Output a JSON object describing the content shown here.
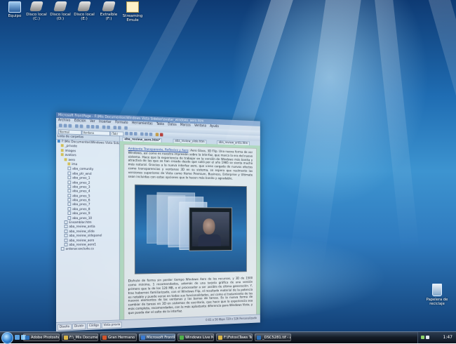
{
  "desktop_icons": [
    {
      "name": "equipo",
      "label": "Equipo",
      "kind": "pc"
    },
    {
      "name": "disco-local-c",
      "label": "Disco local (C:)",
      "kind": "drive"
    },
    {
      "name": "disco-local-d",
      "label": "Disco local (D:)",
      "kind": "drive"
    },
    {
      "name": "disco-local-e",
      "label": "Disco local (E:)",
      "kind": "drive"
    },
    {
      "name": "extraible-f",
      "label": "Extraíble (F:)",
      "kind": "drive"
    },
    {
      "name": "streaming-emule",
      "label": "Streaming Emule",
      "kind": "doc"
    }
  ],
  "recycle_bin": {
    "label": "Papelera de reciclaje"
  },
  "app": {
    "title": "Microsoft FrontPage - F:\\Mis Documentos\\Windows Vista Sidebar\\avatar_windows_aero.htm",
    "menu": [
      "Archivo",
      "Edición",
      "Ver",
      "Insertar",
      "Formato",
      "Herramientas",
      "Tabla",
      "Datos",
      "Marcos",
      "Ventana",
      "Ayuda"
    ],
    "toolbar": {
      "style": "Normal",
      "font": "Verdana",
      "size": "(Tab)"
    },
    "file_panel": {
      "header": "Lista de carpetas",
      "items": [
        {
          "label": "F:\\Mis Documentos\\Windows Vista Sidebar",
          "kind": "site",
          "indent": 0
        },
        {
          "label": "_private",
          "kind": "folder",
          "indent": 1
        },
        {
          "label": "images",
          "kind": "folder",
          "indent": 1
        },
        {
          "label": "avatars",
          "kind": "folder",
          "indent": 1
        },
        {
          "label": "aero",
          "kind": "folder",
          "indent": 2
        },
        {
          "label": "ima",
          "kind": "folder",
          "indent": 3
        },
        {
          "label": "aba_comunity",
          "kind": "file",
          "indent": 3
        },
        {
          "label": "aba_ptr_wnd",
          "kind": "file",
          "indent": 3
        },
        {
          "label": "aba_pnes_1",
          "kind": "file",
          "indent": 3
        },
        {
          "label": "aba_pnes_2",
          "kind": "file",
          "indent": 3
        },
        {
          "label": "aba_pnes_3",
          "kind": "file",
          "indent": 3
        },
        {
          "label": "aba_pnes_4",
          "kind": "file",
          "indent": 3
        },
        {
          "label": "aba_pnes_5",
          "kind": "file",
          "indent": 3
        },
        {
          "label": "aba_pnes_6",
          "kind": "file",
          "indent": 3
        },
        {
          "label": "aba_pnes_7",
          "kind": "file",
          "indent": 3
        },
        {
          "label": "aba_pnes_8",
          "kind": "file",
          "indent": 3
        },
        {
          "label": "aba_pnes_9",
          "kind": "file",
          "indent": 3
        },
        {
          "label": "aba_pnes_10",
          "kind": "file",
          "indent": 3
        },
        {
          "label": "Ensamblar.htm",
          "kind": "file",
          "indent": 2
        },
        {
          "label": "aba_review_antia",
          "kind": "file",
          "indent": 2
        },
        {
          "label": "aba_review_slide",
          "kind": "file",
          "indent": 2
        },
        {
          "label": "aba_review_sidepanel",
          "kind": "file",
          "indent": 2
        },
        {
          "label": "aba_review_aero",
          "kind": "file",
          "indent": 2
        },
        {
          "label": "aba_review_aero1",
          "kind": "file",
          "indent": 2
        },
        {
          "label": "ordenar.exclude.cs",
          "kind": "file",
          "indent": 1
        }
      ]
    },
    "tabs": [
      {
        "label": "aba_review_aero.htm*",
        "active": true
      },
      {
        "label": "aba_review_slide.htm",
        "active": false
      },
      {
        "label": "aba_review_antia.htm",
        "active": false
      }
    ],
    "page_text_top_links": "Ambiente Transparente, Reflexivo y Aero",
    "page_text_top": ": Aero Glass, 3D Flip. Una nueva forma de ver Windows, así como es nuestra impresión sobre la interfaz, que marca la era del nuevo sistema. Hace que la experiencia de trabajar en la versión de Windows más bonita y atractiva de las que se han creado desde que salió por el año 1985 se sienta mucho más natural. Gracias a la nueva interfaz aero, que viene cargada de nuevos efectos como transparencias y ventanas 3D en su sistema, se espera que realmente las versiones superiores de Vista como Home Premium, Business, Enterprise y Ultimate sean incluidas con estas opciones que lo hacen más bonito y agradable.",
    "page_text_bottom": "Disfrute de forma sin perder tiempo Windows Aero de los recursos, y 3D de 1500 como mínimo, 1 recomendados, además de una tarjeta gráfica de una versión primero que la de los 128 MB, o el procesador a ser posible de última generación. Y, tras habernos familiarizado, con el Windows Flip, el resultado material de la potencia es notable y puede verse en todas sus funcionalidades, así como el tratamiento de los nuevos elementos de las ventanas y las barras de tareas. Es la nueva forma de cambiar de tareas en 3D en sistemas de escritorio, que hace que la experiencia sea más completa, recomendados, con la más aplastante diferencia para Windows Vista, y que pueda dar el salto de la interfaz.",
    "status": {
      "tabs": [
        "Diseño",
        "Dividir",
        "Código",
        "Vista previa"
      ],
      "right": "0:01 a 56 Kbps  729 x 526  Personalizado"
    }
  },
  "taskbar": {
    "buttons": [
      {
        "label": "Adobe Photoshop",
        "icon_color": "#2b6fb8",
        "active": false
      },
      {
        "label": "F:\\_Mis Documen...",
        "icon_color": "#d9b64a",
        "active": false
      },
      {
        "label": "Gran Hermano V...",
        "icon_color": "#d0542b",
        "active": false
      },
      {
        "label": "Microsoft FrontP...",
        "icon_color": "#3a7ad0",
        "active": true
      },
      {
        "label": "Windows Live M...",
        "icon_color": "#4fb04a",
        "active": false
      },
      {
        "label": "F:\\Fotos\\Taws Te...",
        "icon_color": "#d9b64a",
        "active": false
      },
      {
        "label": "_DSC5281.tif - Ac...",
        "icon_color": "#2b6fb8",
        "active": false
      }
    ],
    "clock": "1:47"
  }
}
